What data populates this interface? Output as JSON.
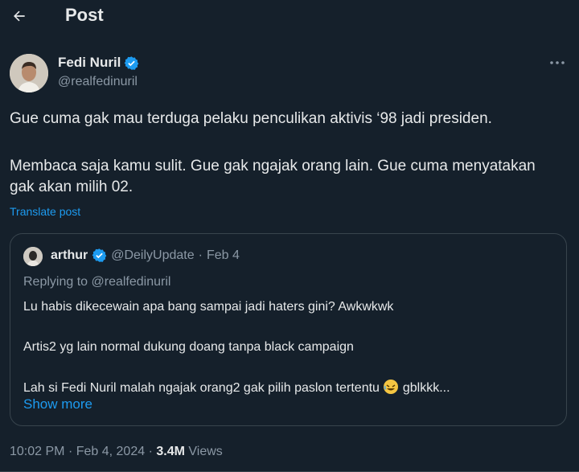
{
  "header": {
    "title": "Post",
    "back_icon": "arrow-left-icon"
  },
  "post": {
    "author": {
      "name": "Fedi Nuril",
      "handle": "@realfedinuril",
      "verified": true
    },
    "paragraphs": [
      "Gue cuma gak mau terduga pelaku penculikan aktivis ‘98 jadi presiden.",
      "Membaca saja kamu sulit. Gue gak ngajak orang lain. Gue cuma menyatakan gak akan milih 02."
    ],
    "translate_label": "Translate post",
    "time": "10:02 PM",
    "date": "Feb 4, 2024",
    "views_count": "3.4M",
    "views_label": "Views"
  },
  "quote": {
    "name": "arthur",
    "handle": "@DeilyUpdate",
    "date": "Feb 4",
    "replying_to": "Replying to @realfedinuril",
    "lines": [
      "Lu habis dikecewain apa bang sampai jadi haters gini? Awkwkwk",
      "Artis2 yg lain normal dukung doang tanpa black campaign",
      "Lah si Fedi Nuril malah ngajak orang2 gak pilih paslon tertentu",
      "gblkkk..."
    ],
    "show_more_label": "Show more"
  },
  "colors": {
    "background": "#15202b",
    "text": "#e7e9ea",
    "muted": "#8b98a5",
    "accent": "#1d9bf0",
    "border": "#38444d"
  }
}
